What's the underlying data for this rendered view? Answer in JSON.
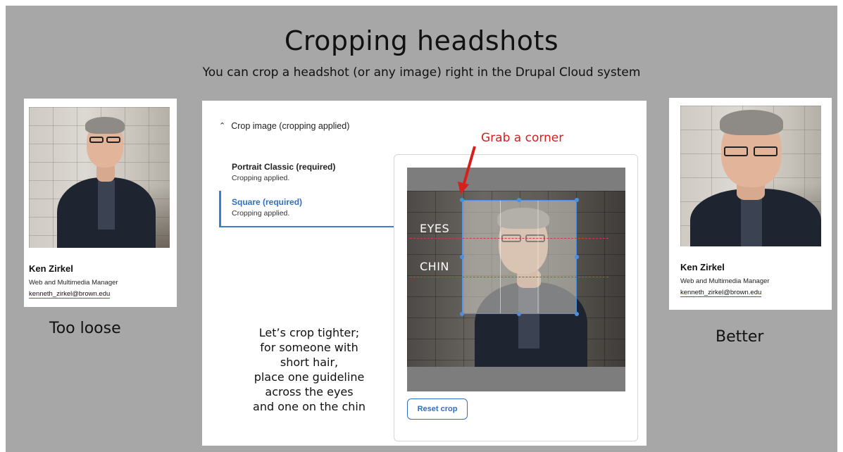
{
  "slide": {
    "title": "Cropping headshots",
    "subtitle": "You can crop a headshot (or any image) right in the Drupal Cloud system"
  },
  "left_card": {
    "name": "Ken Zirkel",
    "role": "Web and Multimedia Manager",
    "email": "kenneth_zirkel@brown.edu",
    "caption": "Too loose"
  },
  "right_card": {
    "name": "Ken Zirkel",
    "role": "Web and Multimedia Manager",
    "email": "kenneth_zirkel@brown.edu",
    "caption": "Better"
  },
  "crop_panel": {
    "header": "Crop image (cropping applied)",
    "items": [
      {
        "title": "Portrait Classic (required)",
        "status": "Cropping applied."
      },
      {
        "title": "Square (required)",
        "status": "Cropping applied."
      }
    ],
    "reset_label": "Reset crop",
    "guides": {
      "eyes": "EYES",
      "chin": "CHIN"
    },
    "annotation": "Grab a corner"
  },
  "instructions": [
    "Let’s crop tighter;",
    "for someone with",
    "short hair,",
    "place one guideline",
    "across the eyes",
    "and one on the chin"
  ],
  "colors": {
    "slide_bg": "#a7a7a7",
    "accent_blue": "#2f6fc3",
    "annotation_red": "#d6201c"
  }
}
